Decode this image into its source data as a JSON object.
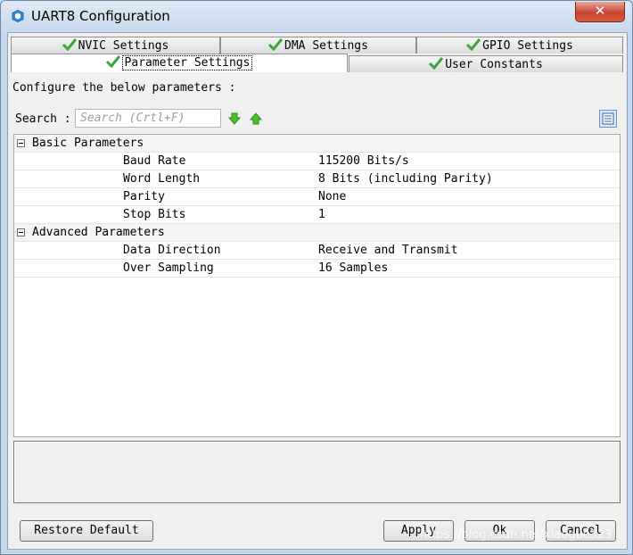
{
  "window": {
    "title": "UART8 Configuration",
    "close_label": "✕",
    "accent_color": "#c7432f"
  },
  "tabs": {
    "row1": [
      {
        "label": "NVIC Settings",
        "icon": "check-icon"
      },
      {
        "label": "DMA Settings",
        "icon": "check-icon"
      },
      {
        "label": "GPIO Settings",
        "icon": "check-icon"
      }
    ],
    "row2": [
      {
        "label": "Parameter Settings",
        "icon": "check-icon",
        "active": true
      },
      {
        "label": "User Constants",
        "icon": "check-icon"
      }
    ]
  },
  "content": {
    "instruction": "Configure the below parameters :",
    "search_label": "Search :",
    "search_placeholder": "Search (Crtl+F)"
  },
  "params": {
    "basic": {
      "label": "Basic Parameters",
      "rows": [
        {
          "name": "Baud Rate",
          "value": "115200 Bits/s"
        },
        {
          "name": "Word Length",
          "value": "8 Bits (including Parity)"
        },
        {
          "name": "Parity",
          "value": "None"
        },
        {
          "name": "Stop Bits",
          "value": "1"
        }
      ]
    },
    "advanced": {
      "label": "Advanced Parameters",
      "rows": [
        {
          "name": "Data Direction",
          "value": "Receive and Transmit"
        },
        {
          "name": "Over Sampling",
          "value": "16 Samples"
        }
      ]
    }
  },
  "buttons": {
    "restore": "Restore Default",
    "apply": "Apply",
    "ok": "Ok",
    "cancel": "Cancel"
  },
  "watermark": "https://blog.csdn.net/xiaoguo323"
}
